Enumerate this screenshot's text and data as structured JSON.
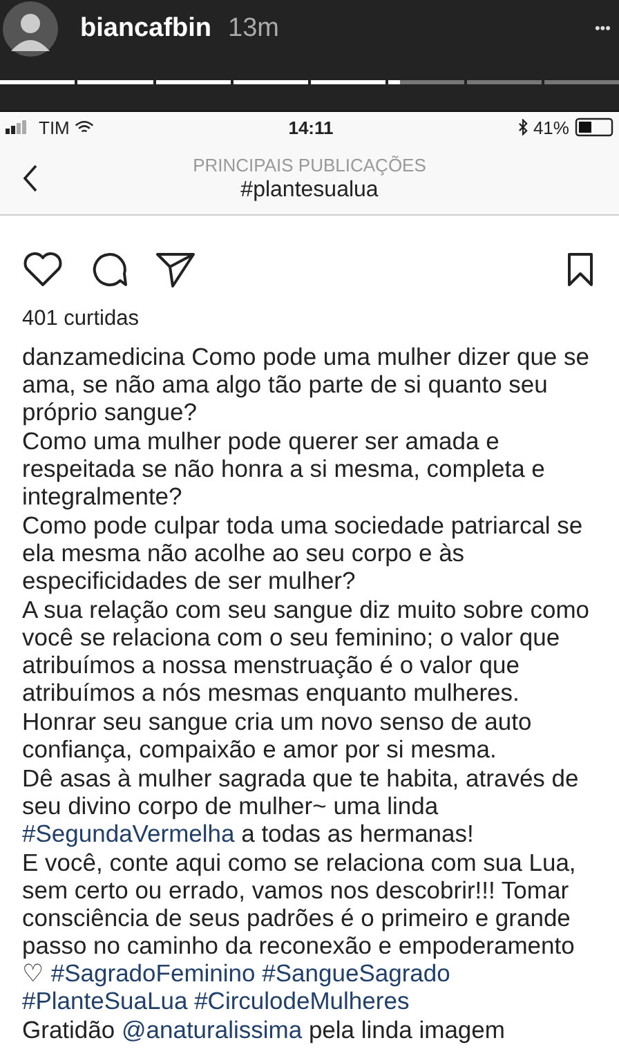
{
  "story": {
    "username": "biancafbin",
    "time": "13m",
    "menu": "•••",
    "progress": [
      {
        "kind": "seen"
      },
      {
        "kind": "seen"
      },
      {
        "kind": "seen"
      },
      {
        "kind": "seen"
      },
      {
        "kind": "seen"
      },
      {
        "kind": "current"
      },
      {
        "kind": "unseen"
      },
      {
        "kind": "unseen"
      }
    ]
  },
  "status_bar": {
    "carrier": "TIM",
    "time": "14:11",
    "battery": "41%"
  },
  "header": {
    "subtitle": "PRINCIPAIS PUBLICAÇÕES",
    "title": "#plantesualua"
  },
  "post": {
    "likes": "401 curtidas",
    "caption": [
      [
        {
          "kind": "user",
          "text": "danzamedicina"
        },
        {
          "kind": "plain",
          "text": " Como pode uma mulher dizer que se ama, se não ama algo tão parte de si quanto seu próprio sangue?"
        }
      ],
      [
        {
          "kind": "plain",
          "text": "Como uma mulher pode querer ser amada e respeitada se não honra a si mesma, completa e integralmente?"
        }
      ],
      [
        {
          "kind": "plain",
          "text": "Como pode culpar toda uma sociedade patriarcal se ela mesma não acolhe ao seu corpo e às especificidades de ser mulher?"
        }
      ],
      [
        {
          "kind": "plain",
          "text": "A sua relação com seu sangue diz muito sobre como você se relaciona com o seu feminino; o valor que atribuímos a nossa menstruação é o valor que atribuímos a nós mesmas enquanto mulheres."
        }
      ],
      [
        {
          "kind": "plain",
          "text": "Honrar seu sangue cria um novo senso de auto confiança, compaixão e amor por si mesma."
        }
      ],
      [
        {
          "kind": "plain",
          "text": "Dê asas à mulher sagrada que te habita, através de seu divino corpo de mulher~ uma linda "
        },
        {
          "kind": "tag",
          "text": "#SegundaVermelha"
        },
        {
          "kind": "plain",
          "text": " a todas as hermanas!"
        }
      ],
      [
        {
          "kind": "plain",
          "text": "E você, conte aqui como se relaciona com sua Lua, sem certo ou errado, vamos nos descobrir!!! Tomar consciência de seus padrões é o primeiro e grande passo no caminho da reconexão e empoderamento ♡ "
        },
        {
          "kind": "tag",
          "text": "#SagradoFeminino"
        },
        {
          "kind": "tag",
          "text": "#SangueSagrado"
        },
        {
          "kind": "tag",
          "text": "#PlanteSuaLua"
        },
        {
          "kind": "tag",
          "text": "#CirculodeMulheres"
        }
      ],
      [
        {
          "kind": "plain",
          "text": "Gratidão "
        },
        {
          "kind": "tag",
          "text": "@anaturalissima"
        },
        {
          "kind": "plain",
          "text": " pela linda imagem"
        }
      ]
    ]
  }
}
